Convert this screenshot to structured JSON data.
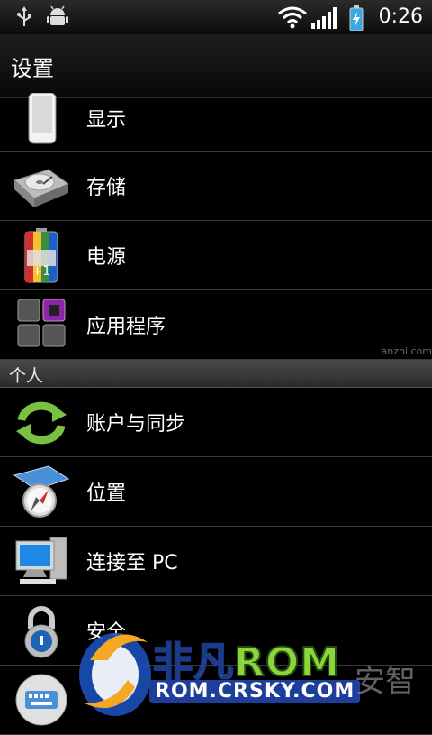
{
  "status_bar": {
    "time": "0:26"
  },
  "header": {
    "title": "设置"
  },
  "settings_group_1": [
    {
      "label": "显示",
      "icon": "phone-display-icon"
    },
    {
      "label": "存储",
      "icon": "hard-drive-icon"
    },
    {
      "label": "电源",
      "icon": "battery-icon"
    },
    {
      "label": "应用程序",
      "icon": "apps-grid-icon"
    }
  ],
  "section_personal": {
    "title": "个人"
  },
  "settings_group_2": [
    {
      "label": "账户与同步",
      "icon": "sync-icon"
    },
    {
      "label": "位置",
      "icon": "location-compass-icon"
    },
    {
      "label": "连接至 PC",
      "icon": "computer-icon"
    },
    {
      "label": "安全",
      "icon": "padlock-icon"
    }
  ],
  "watermark": {
    "brand_prefix": "非凡",
    "brand_suffix": "ROM",
    "url": "ROM.CRSKY.COM",
    "anzhi": "安智",
    "anzhi_small": "anzhi.com"
  }
}
